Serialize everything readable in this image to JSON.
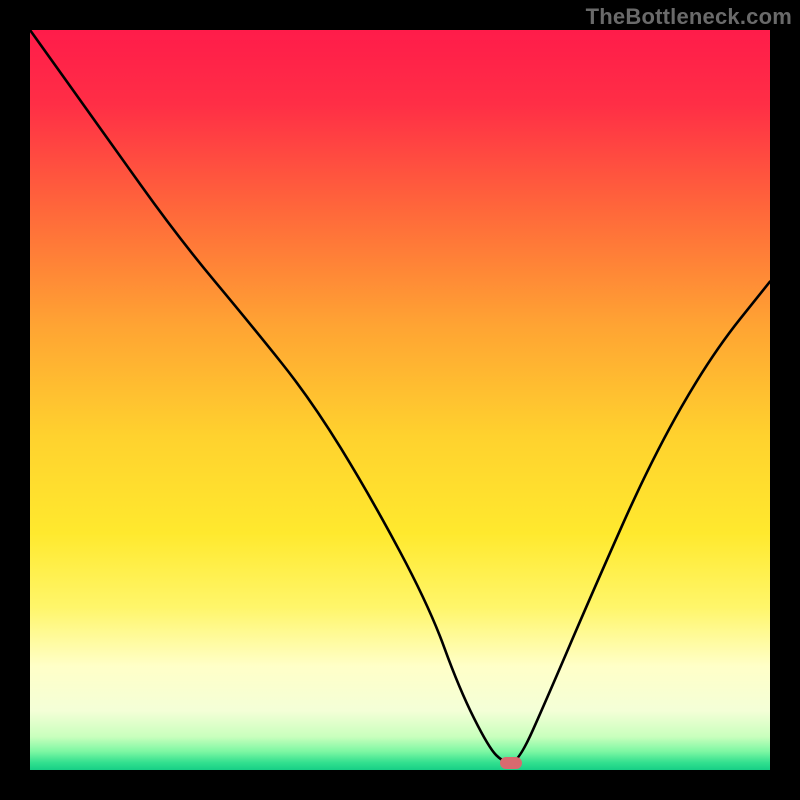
{
  "watermark": "TheBottleneck.com",
  "colors": {
    "background": "#000000",
    "gradient_stops": [
      {
        "offset": 0.0,
        "color": "#ff1c4a"
      },
      {
        "offset": 0.1,
        "color": "#ff2e46"
      },
      {
        "offset": 0.25,
        "color": "#ff6a3a"
      },
      {
        "offset": 0.4,
        "color": "#ffa433"
      },
      {
        "offset": 0.55,
        "color": "#ffd22e"
      },
      {
        "offset": 0.68,
        "color": "#ffe92e"
      },
      {
        "offset": 0.78,
        "color": "#fff66a"
      },
      {
        "offset": 0.86,
        "color": "#ffffc8"
      },
      {
        "offset": 0.92,
        "color": "#f4ffd7"
      },
      {
        "offset": 0.955,
        "color": "#c9ffbd"
      },
      {
        "offset": 0.975,
        "color": "#7df7a3"
      },
      {
        "offset": 0.99,
        "color": "#32e08f"
      },
      {
        "offset": 1.0,
        "color": "#17cf86"
      }
    ],
    "curve": "#000000",
    "marker": "#d86a6f"
  },
  "chart_data": {
    "type": "line",
    "title": "",
    "xlabel": "",
    "ylabel": "",
    "xlim": [
      0,
      100
    ],
    "ylim": [
      0,
      100
    ],
    "grid": false,
    "legend": false,
    "series": [
      {
        "name": "bottleneck-curve",
        "x": [
          0,
          10,
          20,
          30,
          38,
          46,
          54,
          58,
          62,
          64,
          66,
          70,
          76,
          84,
          92,
          100
        ],
        "values": [
          100,
          86,
          72,
          60,
          50,
          37,
          22,
          11,
          3,
          1,
          1,
          10,
          24,
          42,
          56,
          66
        ]
      }
    ],
    "marker": {
      "x": 65,
      "y": 1
    },
    "note": "x/y are percentages of the plot area; y=0 is the bottom edge of the gradient, y=100 is the top."
  }
}
